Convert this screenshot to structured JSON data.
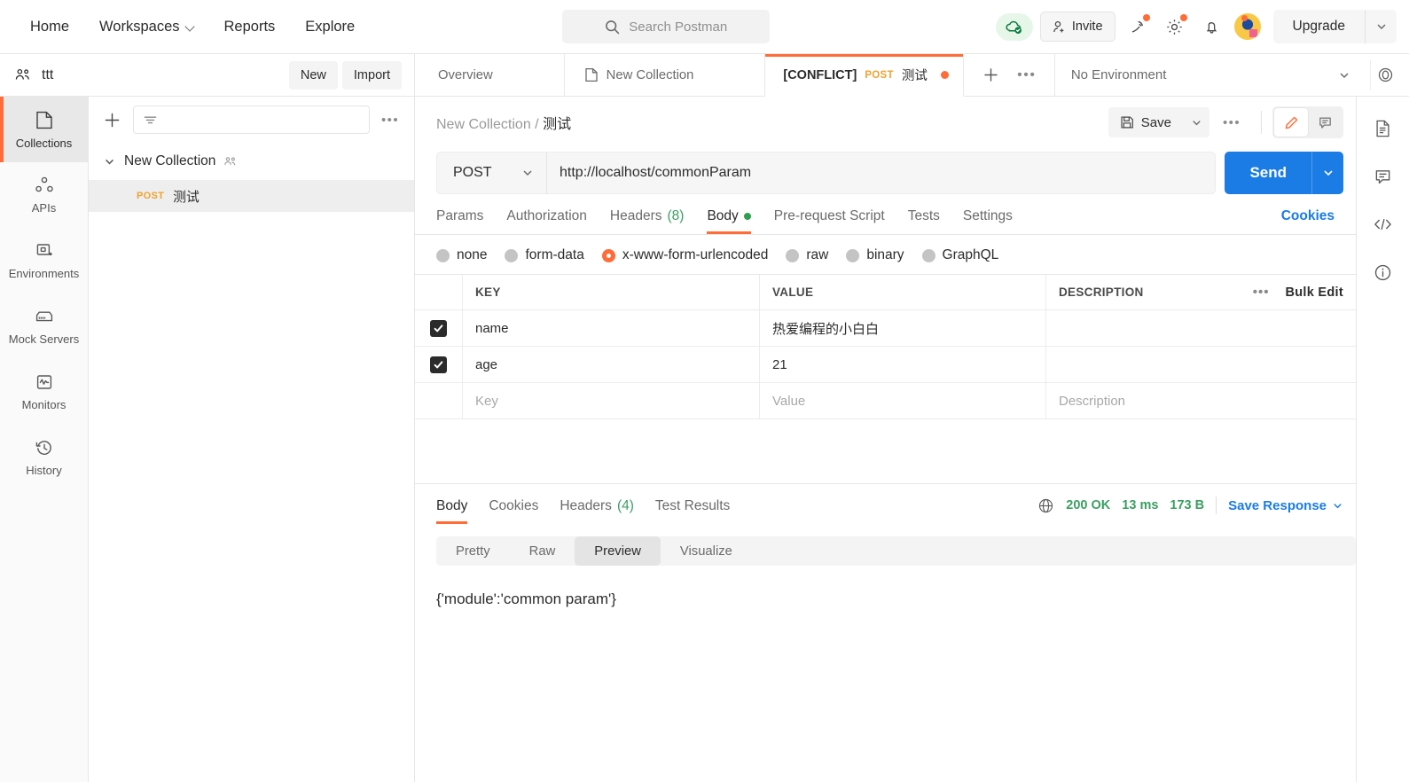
{
  "topbar": {
    "nav": [
      {
        "label": "Home",
        "has_caret": false
      },
      {
        "label": "Workspaces",
        "has_caret": true
      },
      {
        "label": "Reports",
        "has_caret": false
      },
      {
        "label": "Explore",
        "has_caret": false
      }
    ],
    "search_placeholder": "Search Postman",
    "invite_label": "Invite",
    "upgrade_label": "Upgrade",
    "icons": [
      "cloud-sync-icon",
      "satellite-icon",
      "gear-icon",
      "bell-icon",
      "avatar"
    ]
  },
  "workspace": {
    "name": "ttt",
    "new_label": "New",
    "import_label": "Import"
  },
  "tabs": {
    "items": [
      {
        "label": "Overview",
        "type": "overview"
      },
      {
        "label": "New Collection",
        "type": "collection"
      }
    ],
    "active": {
      "conflict_label": "[CONFLICT]",
      "method": "POST",
      "title": "测试",
      "unsaved": true
    },
    "environment": "No Environment"
  },
  "sidebar": {
    "items": [
      {
        "label": "Collections",
        "icon": "collections-icon",
        "active": true
      },
      {
        "label": "APIs",
        "icon": "apis-icon",
        "active": false
      },
      {
        "label": "Environments",
        "icon": "environments-icon",
        "active": false
      },
      {
        "label": "Mock Servers",
        "icon": "mock-servers-icon",
        "active": false
      },
      {
        "label": "Monitors",
        "icon": "monitors-icon",
        "active": false
      },
      {
        "label": "History",
        "icon": "history-icon",
        "active": false
      }
    ]
  },
  "collections": {
    "filter_placeholder": "",
    "tree": [
      {
        "label": "New Collection",
        "shared": true,
        "expanded": true
      },
      {
        "label": "测试",
        "method": "POST",
        "selected": true
      }
    ]
  },
  "request": {
    "breadcrumb_collection": "New Collection",
    "breadcrumb_separator": "/",
    "breadcrumb_name": "测试",
    "save_label": "Save",
    "method": "POST",
    "url": "http://localhost/commonParam",
    "send_label": "Send",
    "tabs": [
      {
        "label": "Params",
        "active": false
      },
      {
        "label": "Authorization",
        "active": false
      },
      {
        "label": "Headers",
        "count": "(8)",
        "active": false
      },
      {
        "label": "Body",
        "dot": true,
        "active": true
      },
      {
        "label": "Pre-request Script",
        "active": false
      },
      {
        "label": "Tests",
        "active": false
      },
      {
        "label": "Settings",
        "active": false
      }
    ],
    "cookies_label": "Cookies",
    "body_types": [
      {
        "label": "none",
        "selected": false
      },
      {
        "label": "form-data",
        "selected": false
      },
      {
        "label": "x-www-form-urlencoded",
        "selected": true
      },
      {
        "label": "raw",
        "selected": false
      },
      {
        "label": "binary",
        "selected": false
      },
      {
        "label": "GraphQL",
        "selected": false
      }
    ],
    "table": {
      "headers": [
        "KEY",
        "VALUE",
        "DESCRIPTION"
      ],
      "bulk_edit_label": "Bulk Edit",
      "rows": [
        {
          "checked": true,
          "key": "name",
          "value": "热爱编程的小白白",
          "description": ""
        },
        {
          "checked": true,
          "key": "age",
          "value": "21",
          "description": ""
        }
      ],
      "placeholder_row": {
        "key": "Key",
        "value": "Value",
        "description": "Description"
      }
    }
  },
  "response": {
    "tabs": [
      {
        "label": "Body",
        "active": true
      },
      {
        "label": "Cookies",
        "active": false
      },
      {
        "label": "Headers",
        "count": "(4)",
        "active": false
      },
      {
        "label": "Test Results",
        "active": false
      }
    ],
    "status": "200 OK",
    "time": "13 ms",
    "size": "173 B",
    "save_response_label": "Save Response",
    "view_modes": [
      {
        "label": "Pretty",
        "active": false
      },
      {
        "label": "Raw",
        "active": false
      },
      {
        "label": "Preview",
        "active": true
      },
      {
        "label": "Visualize",
        "active": false
      }
    ],
    "body_text": "{'module':'common param'}"
  },
  "right_rail": {
    "items": [
      "documentation-icon",
      "comment-icon",
      "code-icon",
      "info-icon"
    ]
  },
  "colors": {
    "accent": "#ff6c37",
    "link": "#1a7ce4",
    "success": "#3aa062",
    "method_post": "#f0a330"
  }
}
